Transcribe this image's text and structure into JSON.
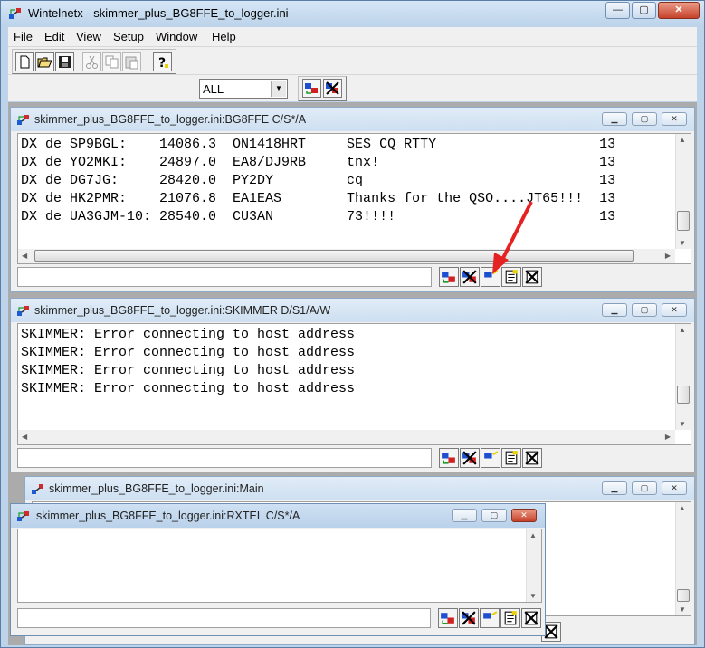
{
  "app": {
    "title": "Wintelnetx - skimmer_plus_BG8FFE_to_logger.ini",
    "controls": {
      "minimize": "—",
      "maximize": "▢",
      "close": "✕"
    }
  },
  "menu": [
    "File",
    "Edit",
    "View",
    "Setup",
    "Window",
    "Help"
  ],
  "toolbar": {
    "filter_select": {
      "value": "ALL",
      "options_visible": [
        "ALL"
      ]
    },
    "icons": [
      "new-file-icon",
      "open-folder-icon",
      "save-disk-icon",
      "cut-scissors-icon",
      "copy-icon",
      "paste-icon",
      "help-question-icon",
      "connect-icon",
      "disconnect-icon"
    ]
  },
  "windows": {
    "bg8ffe": {
      "title": "skimmer_plus_BG8FFE_to_logger.ini:BG8FFE C/S*/A",
      "lines": [
        "DX de SP9BGL:    14086.3  ON1418HRT     SES CQ RTTY                    13",
        "DX de YO2MKI:    24897.0  EA8/DJ9RB     tnx!                           13",
        "DX de DG7JG:     28420.0  PY2DY         cq                             13",
        "DX de HK2PMR:    21076.8  EA1EAS        Thanks for the QSO....JT65!!!  13",
        "DX de UA3GJM-10: 28540.0  CU3AN         73!!!!                         13"
      ],
      "input_value": ""
    },
    "skimmer": {
      "title": "skimmer_plus_BG8FFE_to_logger.ini:SKIMMER D/S1/A/W",
      "lines": [
        "SKIMMER: Error connecting to host address",
        "SKIMMER: Error connecting to host address",
        "SKIMMER: Error connecting to host address",
        "SKIMMER: Error connecting to host address"
      ],
      "input_value": ""
    },
    "main": {
      "title": "skimmer_plus_BG8FFE_to_logger.ini:Main"
    },
    "rxtel": {
      "title": "skimmer_plus_BG8FFE_to_logger.ini:RXTEL C/S*/A",
      "lines": [],
      "input_value": ""
    }
  },
  "colors": {
    "title_bg": "#bcd3ea",
    "mdi_bg": "#ababab",
    "annotation_arrow": "#e52222",
    "close_red": "#c8412a"
  }
}
